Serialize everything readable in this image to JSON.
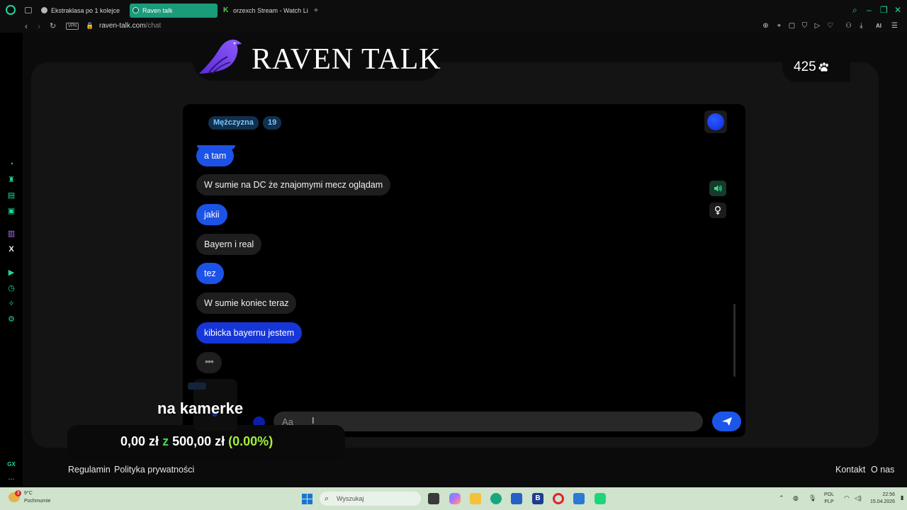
{
  "browser": {
    "tabs": [
      {
        "label": "Ekstraklasa po 1 kolejce"
      },
      {
        "label": "Raven talk"
      },
      {
        "label": "orzexch Stream - Watch Live"
      }
    ],
    "new_tab": "+",
    "url_domain": "raven-talk.com",
    "url_path": "/chat",
    "vpn_label": "VPN",
    "ai_label": "AI"
  },
  "sidebar": {
    "gx_label": "GX",
    "more_label": "..."
  },
  "header": {
    "title": "RAVEN TALK",
    "online_count": "425"
  },
  "chat": {
    "partner_gender": "Mężczyzna",
    "partner_age": "19",
    "messages": [
      {
        "from": "me",
        "text": "a tam"
      },
      {
        "from": "them",
        "text": "W sumie na DC że znajomymi mecz oglądam"
      },
      {
        "from": "me",
        "text": "jakii"
      },
      {
        "from": "them",
        "text": "Bayern i real"
      },
      {
        "from": "me",
        "text": "tez"
      },
      {
        "from": "them",
        "text": "W sumie koniec teraz"
      },
      {
        "from": "me",
        "text": "kibicka bayernu jestem"
      }
    ],
    "typing_indicator": "•••",
    "input_placeholder": "Aa"
  },
  "overlay": {
    "caption": "na kamerke",
    "donation_current": "0,00 zł",
    "donation_sep": "z",
    "donation_goal": "500,00 zł",
    "donation_pct": "(0.00%)"
  },
  "footer": {
    "rules": "Regulamin",
    "privacy": "Polityka prywatności",
    "contact": "Kontakt",
    "about": "O nas"
  },
  "taskbar": {
    "weather_temp": "9°C",
    "weather_desc": "Pochmurnie",
    "weather_badge": "3",
    "search_placeholder": "Wyszukaj",
    "lang_top": "POL",
    "lang_bottom": "PLP",
    "time": "22:56",
    "date": "15.04.2026"
  },
  "colors": {
    "accent": "#1ed6a1",
    "my_bubble": "#1d52e6",
    "their_bubble": "#1e1e1e",
    "goal_green": "#3ddc49"
  }
}
